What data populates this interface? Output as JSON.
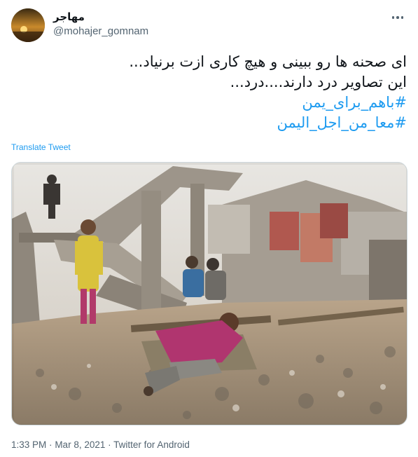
{
  "tweet": {
    "display_name": "مهاجر",
    "handle": "@mohajer_gomnam",
    "avatar_icon": "sunset-avatar-icon",
    "more_icon": "more-options-icon",
    "lines": [
      "ای صحنه ها رو ببینی و هیچ کاری ازت برنیاد...",
      "این تصاویر درد دارند....درد..."
    ],
    "hashtags": [
      "#باهم_برای_یمن",
      "#معا_من_اجل_اليمن"
    ],
    "translate_label": "Translate Tweet",
    "photo_icon": "war-ruins-children-photo",
    "time": "1:33 PM",
    "separator": "·",
    "date": "Mar 8, 2021",
    "source": "Twitter for Android"
  },
  "colors": {
    "link": "#1d9bf0",
    "secondary_text": "#536471",
    "primary_text": "#0f1419",
    "border": "#cfd9de"
  }
}
